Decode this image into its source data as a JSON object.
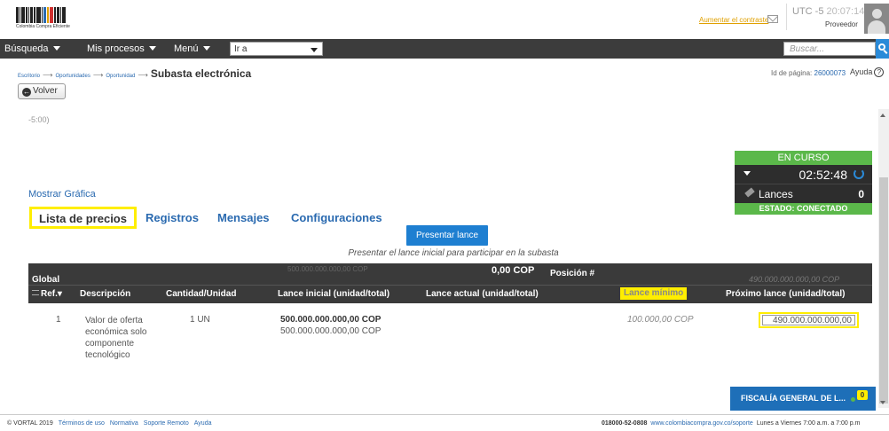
{
  "header": {
    "logo_caption": "Colombia Compra Eficiente",
    "contrast_link": "Aumentar el contraste",
    "utc_label": "UTC -5",
    "utc_time": "20:07:14",
    "role": "Proveedor"
  },
  "nav": {
    "busqueda": "Búsqueda",
    "mis_procesos": "Mis procesos",
    "menu": "Menú",
    "ira_value": "Ir a",
    "search_placeholder": "Buscar..."
  },
  "breadcrumb": {
    "items": [
      "Escritorio",
      "Oportunidades",
      "Oportunidad"
    ],
    "current": "Subasta electrónica",
    "page_id_label": "Id de página:",
    "page_id": "26000073",
    "help": "Ayuda"
  },
  "back_button": "Volver",
  "tz_text": "-5:00)",
  "mostrar_grafica": "Mostrar Gráfica",
  "tabs": [
    {
      "label": "Lista de precios"
    },
    {
      "label": "Registros"
    },
    {
      "label": "Mensajes"
    },
    {
      "label": "Configuraciones"
    }
  ],
  "status": {
    "state": "EN CURSO",
    "timer": "02:52:48",
    "lances_label": "Lances",
    "lances_count": "0",
    "connection": "ESTADO: CONECTADO"
  },
  "submit": {
    "label": "Presentar lance",
    "hint": "Presentar el lance inicial para participar en la subasta"
  },
  "table": {
    "global_label": "Global",
    "global_initial": "500.000.000.000,00 COP",
    "global_current": "0,00 COP",
    "position_label": "Posición #",
    "global_next": "490.000.000.000,00 COP",
    "columns": [
      "Ref.",
      "Descripción",
      "Cantidad/Unidad",
      "Lance inicial (unidad/total)",
      "Lance actual (unidad/total)",
      "Lance mínimo",
      "Próximo lance (unidad/total)"
    ],
    "rows": [
      {
        "ref": "1",
        "description": "Valor de oferta económica solo componente tecnológico",
        "quantity": "1 UN",
        "initial_unit": "500.000.000.000,00 COP",
        "initial_total": "500.000.000.000,00 COP",
        "current": "",
        "minimum": "100.000,00 COP",
        "next_value": "490.000.000.000,00"
      }
    ]
  },
  "popup": {
    "label": "FISCALÍA GENERAL DE L...",
    "badge": "0"
  },
  "footer": {
    "copyright": "© VORTAL 2019",
    "links": [
      "Términos de uso",
      "Normativa",
      "Soporte Remoto",
      "Ayuda"
    ],
    "phone": "018000-52-0808",
    "site": "www.colombiacompra.gov.co/soporte",
    "hours": "Lunes a Viernes 7:00 a.m. a 7:00 p.m"
  },
  "colors": {
    "accent_blue": "#1e7fd1",
    "status_green": "#5bb84a",
    "highlight_yellow": "#ffee00",
    "nav_dark": "#3c3c3c"
  }
}
